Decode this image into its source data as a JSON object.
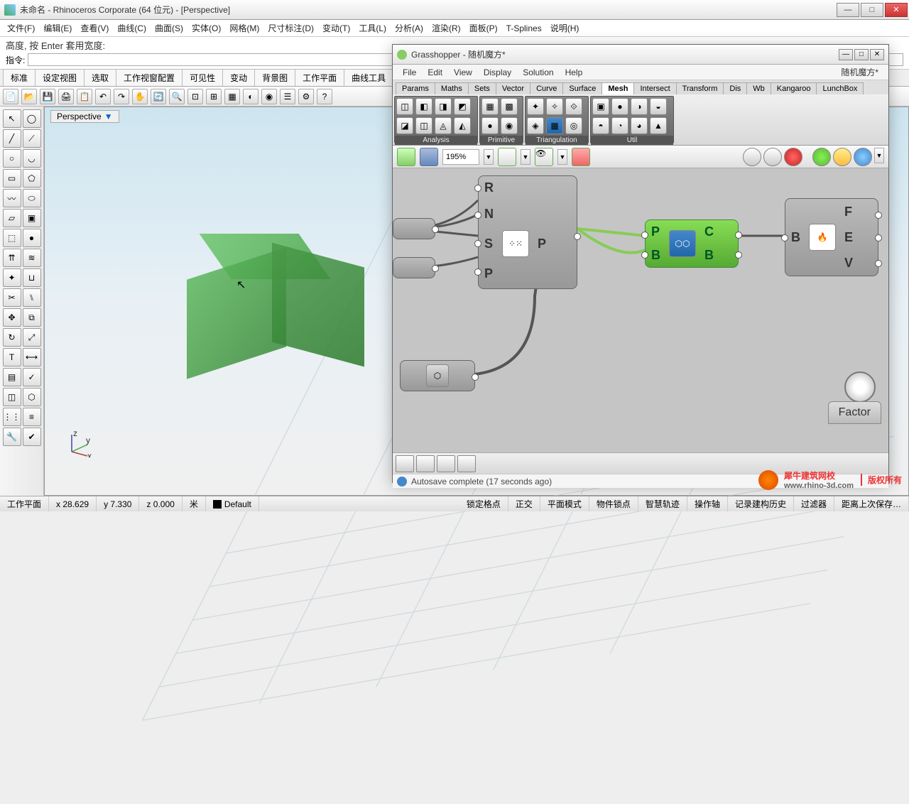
{
  "title": "未命名 - Rhinoceros Corporate (64 位元) - [Perspective]",
  "menu": [
    "文件(F)",
    "编辑(E)",
    "查看(V)",
    "曲线(C)",
    "曲面(S)",
    "实体(O)",
    "网格(M)",
    "尺寸标注(D)",
    "变动(T)",
    "工具(L)",
    "分析(A)",
    "渲染(R)",
    "面板(P)",
    "T-Splines",
    "说明(H)"
  ],
  "cmd_prompt": "高度, 按 Enter 套用宽度:",
  "cmd_label": "指令:",
  "tabs": [
    "标准",
    "设定视图",
    "选取",
    "工作视窗配置",
    "可见性",
    "变动",
    "背景图",
    "工作平面",
    "曲线工具"
  ],
  "viewport_label": "Perspective",
  "status": {
    "plane": "工作平面",
    "x": "x 28.629",
    "y": "y 7.330",
    "z": "z 0.000",
    "unit": "米",
    "layer": "Default",
    "cells": [
      "锁定格点",
      "正交",
      "平面模式",
      "物件锁点",
      "智慧轨迹",
      "操作轴",
      "记录建构历史",
      "过滤器",
      "距离上次保存…"
    ]
  },
  "gh": {
    "title": "Grasshopper - 随机魔方*",
    "doc": "随机魔方*",
    "menu": [
      "File",
      "Edit",
      "View",
      "Display",
      "Solution",
      "Help"
    ],
    "tabs": [
      "Params",
      "Maths",
      "Sets",
      "Vector",
      "Curve",
      "Surface",
      "Mesh",
      "Intersect",
      "Transform",
      "Dis",
      "Wb",
      "Kangaroo",
      "LunchBox"
    ],
    "active_tab": "Mesh",
    "groups": [
      "Analysis",
      "Primitive",
      "Triangulation",
      "Util"
    ],
    "zoom": "195%",
    "node1": {
      "ports": [
        "R",
        "N",
        "P",
        "S",
        "P"
      ]
    },
    "node2": {
      "in": [
        "P",
        "B"
      ],
      "out": [
        "C",
        "B"
      ]
    },
    "node3": {
      "in": [
        "B"
      ],
      "out": [
        "F",
        "E",
        "V"
      ]
    },
    "factor": "Factor",
    "status": "Autosave complete (17 seconds ago)"
  },
  "watermark": {
    "brand": "犀牛建筑网校",
    "url": "www.rhino-3d.com",
    "cr": "版权所有"
  }
}
